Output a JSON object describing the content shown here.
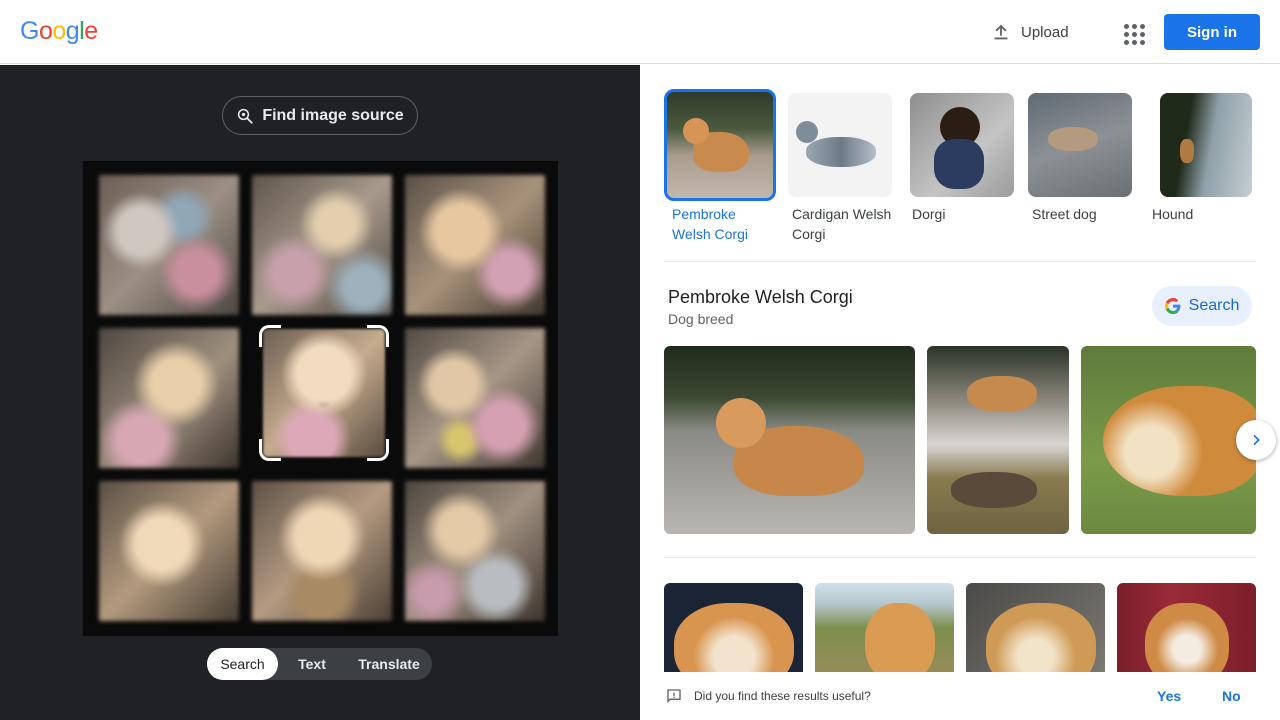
{
  "header": {
    "logo_letters": [
      "G",
      "o",
      "o",
      "g",
      "l",
      "e"
    ],
    "logo_colors": [
      "#4285f4",
      "#ea4335",
      "#fbbc05",
      "#4285f4",
      "#34a853",
      "#ea4335"
    ],
    "upload_label": "Upload",
    "signin_label": "Sign in",
    "apps_icon": "apps-grid-icon"
  },
  "lens": {
    "find_source_label": "Find image source",
    "modes": [
      "Search",
      "Text",
      "Translate"
    ],
    "active_mode": "Search"
  },
  "matches": [
    {
      "label": "Pembroke Welsh Corgi",
      "selected": true
    },
    {
      "label": "Cardigan Welsh Corgi",
      "selected": false
    },
    {
      "label": "Dorgi",
      "selected": false
    },
    {
      "label": "Street dog",
      "selected": false
    },
    {
      "label": "Hound",
      "selected": false
    }
  ],
  "entity": {
    "title": "Pembroke Welsh Corgi",
    "subtitle": "Dog breed",
    "search_label": "Search"
  },
  "feedback": {
    "question": "Did you find these results useful?",
    "yes": "Yes",
    "no": "No"
  },
  "colors": {
    "accent": "#1a73e8",
    "dark_panel": "#202124"
  }
}
